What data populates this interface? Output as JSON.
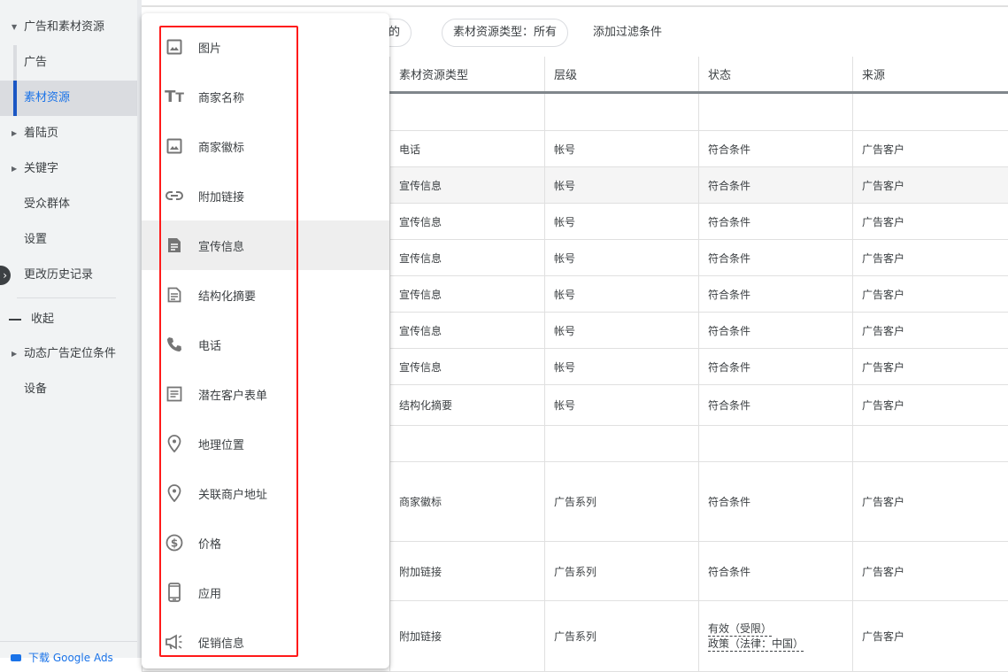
{
  "sidebar": {
    "items": [
      {
        "label": "广告和素材资源",
        "caret": "down"
      },
      {
        "label": "广告"
      },
      {
        "label": "素材资源",
        "selected": true
      },
      {
        "label": "着陆页",
        "caret": "right"
      },
      {
        "label": "关键字",
        "caret": "right"
      },
      {
        "label": "受众群体"
      },
      {
        "label": "设置"
      },
      {
        "label": "更改历史记录"
      },
      {
        "label": "收起"
      },
      {
        "label": "动态广告定位条件",
        "caret": "right"
      },
      {
        "label": "设备"
      }
    ],
    "download": "下载 Google Ads"
  },
  "filters": {
    "chip1": "移除的",
    "chip2": "素材资源类型：所有",
    "add": "添加过滤条件"
  },
  "table": {
    "headers": [
      "素材资源类型",
      "层级",
      "状态",
      "来源"
    ],
    "rows": [
      [
        "电话",
        "帐号",
        "符合条件",
        "广告客户"
      ],
      [
        "宣传信息",
        "帐号",
        "符合条件",
        "广告客户"
      ],
      [
        "宣传信息",
        "帐号",
        "符合条件",
        "广告客户"
      ],
      [
        "宣传信息",
        "帐号",
        "符合条件",
        "广告客户"
      ],
      [
        "宣传信息",
        "帐号",
        "符合条件",
        "广告客户"
      ],
      [
        "宣传信息",
        "帐号",
        "符合条件",
        "广告客户"
      ],
      [
        "宣传信息",
        "帐号",
        "符合条件",
        "广告客户"
      ],
      [
        "结构化摘要",
        "帐号",
        "符合条件",
        "广告客户"
      ],
      [
        "商家徽标",
        "广告系列",
        "符合条件",
        "广告客户"
      ],
      [
        "附加链接",
        "广告系列",
        "符合条件",
        "广告客户"
      ],
      [
        "附加链接",
        "广告系列",
        "有效（受限）",
        "广告客户"
      ]
    ],
    "last_status_line2": "政策（法律：中国）"
  },
  "menu": {
    "items": [
      {
        "label": "图片",
        "icon": "image-icon"
      },
      {
        "label": "商家名称",
        "icon": "text-fields-icon"
      },
      {
        "label": "商家徽标",
        "icon": "image-icon"
      },
      {
        "label": "附加链接",
        "icon": "link-icon"
      },
      {
        "label": "宣传信息",
        "icon": "article-icon",
        "highlighted": true
      },
      {
        "label": "结构化摘要",
        "icon": "document-icon"
      },
      {
        "label": "电话",
        "icon": "phone-icon"
      },
      {
        "label": "潜在客户表单",
        "icon": "form-icon"
      },
      {
        "label": "地理位置",
        "icon": "location-pin-icon"
      },
      {
        "label": "关联商户地址",
        "icon": "location-pin-icon"
      },
      {
        "label": "价格",
        "icon": "dollar-circle-icon"
      },
      {
        "label": "应用",
        "icon": "smartphone-icon"
      },
      {
        "label": "促销信息",
        "icon": "megaphone-icon"
      }
    ]
  },
  "colors": {
    "accent": "#1a73e8",
    "annotation": "#ff1a1a"
  }
}
